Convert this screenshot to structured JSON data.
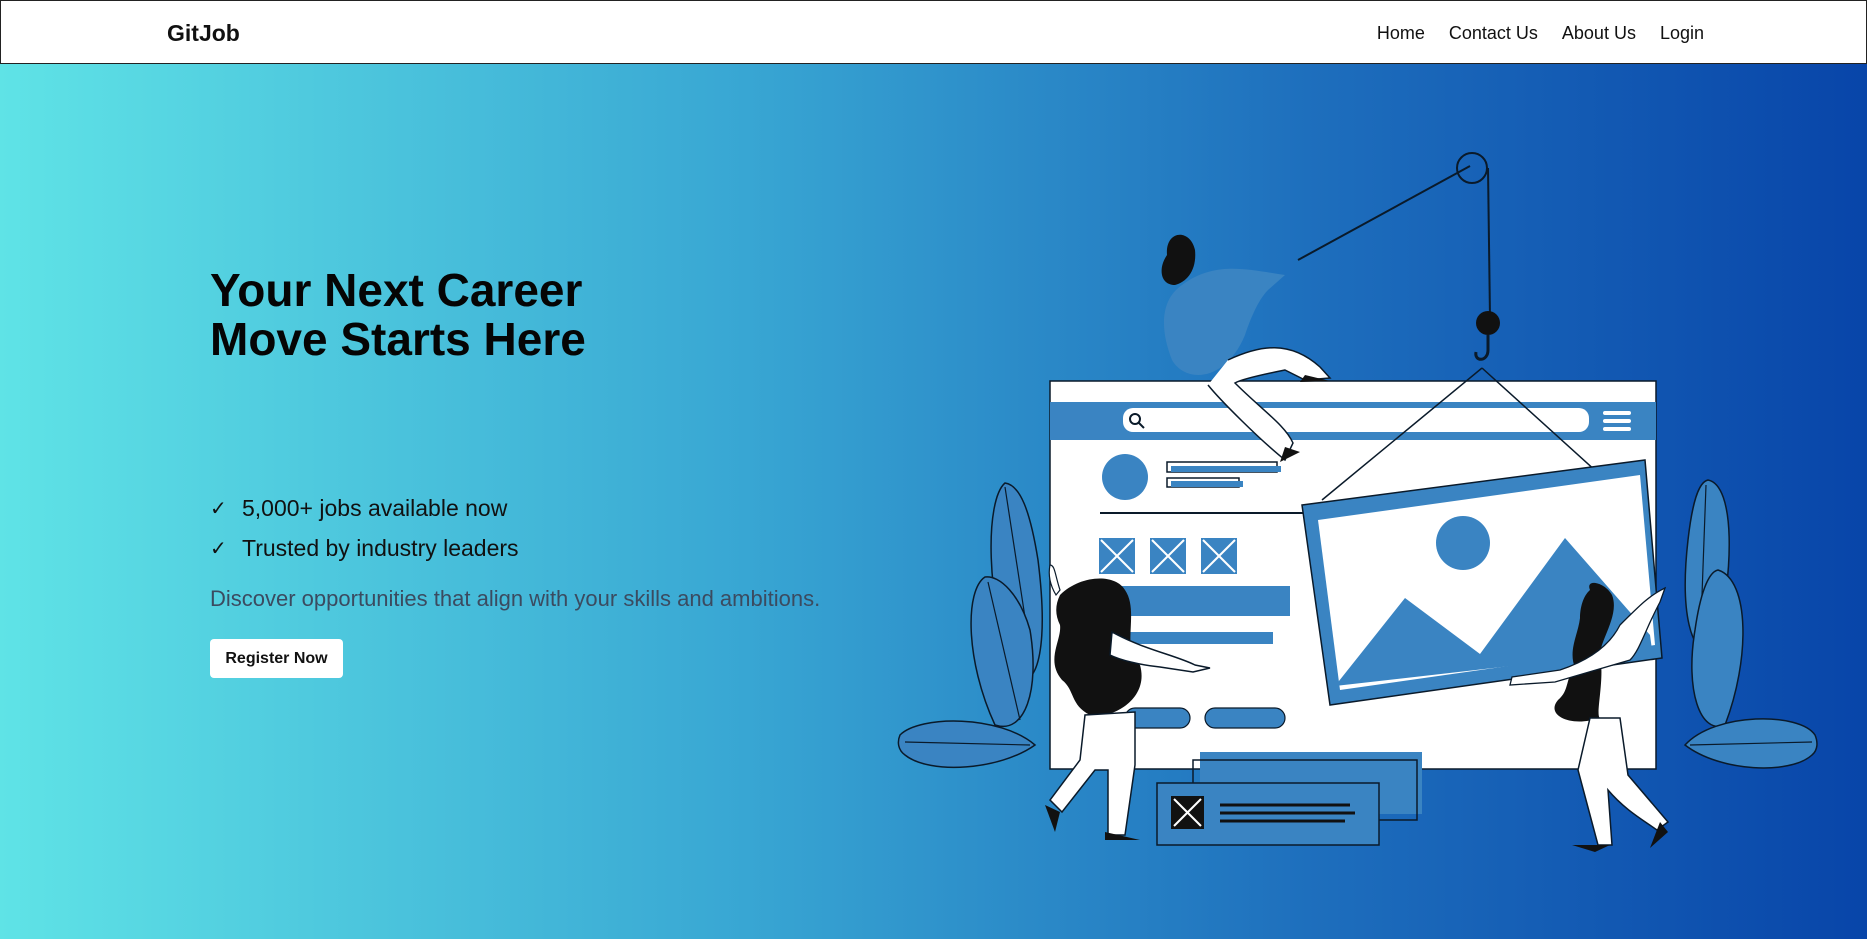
{
  "nav": {
    "brand": "GitJob",
    "links": [
      "Home",
      "Contact Us",
      "About Us",
      "Login"
    ]
  },
  "hero": {
    "headline": "Your Next Career Move Starts Here",
    "checks": [
      "5,000+ jobs available now",
      "Trusted by industry leaders"
    ],
    "subtext": "Discover opportunities that align with your skills and ambitions.",
    "register_label": "Register Now"
  },
  "icons": {
    "check": "check-icon",
    "search": "search-icon",
    "menu": "hamburger-menu-icon"
  },
  "colors": {
    "gradient_start": "#5fe3e6",
    "gradient_end": "#0845a9",
    "illustration_blue": "#3a84c2"
  }
}
